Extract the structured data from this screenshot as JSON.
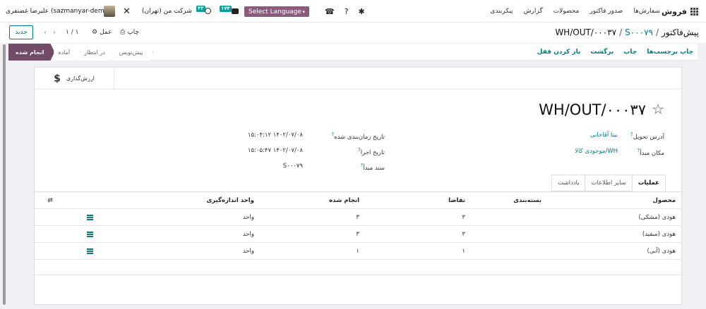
{
  "navbar": {
    "brand": "فروش",
    "menu": [
      "سفارش‌ها",
      "صدور فاکتور",
      "محصولات",
      "گزارش",
      "پیکربندی"
    ],
    "user_name": "علیرضا غضنفری (sazmanyar-demo)",
    "company": "شرکت من (تهران)",
    "activity_badge": "۴۳",
    "chat_badge": "۱۷۴",
    "language_select": "Select Language",
    "icons": [
      "apps-icon",
      "tools-icon",
      "clock-icon",
      "chat-icon",
      "phone-icon",
      "help-icon",
      "bug-icon"
    ]
  },
  "control": {
    "breadcrumb_parent": "پیش‌فاکتور",
    "breadcrumb_middle": "S۰۰۰۷۹",
    "breadcrumb_current": "WH/OUT/۰۰۰۳۷",
    "new_button": "جدید",
    "pager": "۱ / ۱",
    "print_label": "چاپ",
    "action_label": "عمل"
  },
  "status": {
    "actions": [
      "چاپ برچسب‌ها",
      "چاپ",
      "برگشت",
      "باز کردن قفل"
    ],
    "steps": [
      "انجام شده",
      "آماده",
      "در انتظار",
      "پیش‌نویس"
    ],
    "active_step": "انجام شده"
  },
  "smart_button": {
    "label": "ارزش‌گذاری",
    "icon": "dollar-icon"
  },
  "record": {
    "title": "WH/OUT/۰۰۰۳۷",
    "delivery_address_label": "آدرس تحویل",
    "delivery_address": "بیتا آقاخانی",
    "source_location_label": "مکان مبدأ",
    "source_location": "WH/موجودی کالا",
    "scheduled_date_label": "تاریخ زمان‌بندی شده",
    "scheduled_date": "۱۴۰۲/۰۷/۰۸ ۱۵:۰۴:۱۲",
    "effective_date_label": "تاریخ اجرا",
    "effective_date": "۱۴۰۲/۰۷/۰۸ ۱۵:۰۵:۴۷",
    "source_document_label": "سند مبدأ",
    "source_document": "S۰۰۰۷۹"
  },
  "tabs": [
    "عملیات",
    "سایر اطلاعات",
    "یادداشت"
  ],
  "active_tab": "عملیات",
  "operations": {
    "columns": [
      "محصول",
      "بسته‌بندی",
      "تقاضا",
      "انجام شده",
      "واحد اندازه‌گیری"
    ],
    "rows": [
      {
        "product": "هودی (مشکی)",
        "packaging": "",
        "demand": "۳",
        "done": "۳",
        "uom": "واحد"
      },
      {
        "product": "هودی (سفید)",
        "packaging": "",
        "demand": "۳",
        "done": "۳",
        "uom": "واحد"
      },
      {
        "product": "هودی (آبی)",
        "packaging": "",
        "demand": "۱",
        "done": "۱",
        "uom": "واحد"
      }
    ]
  },
  "colors": {
    "accent": "#017e84",
    "brand": "#714b67",
    "language_select": "#8a5b7c",
    "badge": "#00a09d"
  }
}
